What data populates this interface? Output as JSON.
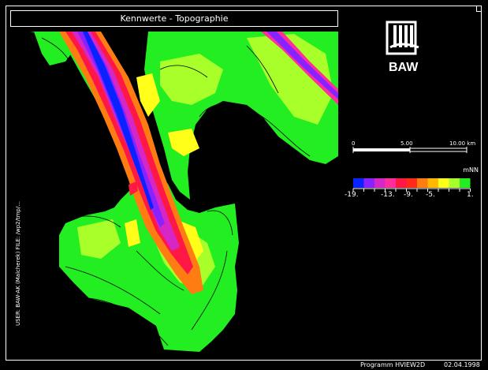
{
  "title": "Kennwerte - Topographie",
  "logo_text": "BAW",
  "scale": {
    "labels": [
      "0",
      "5.00",
      "10.00 km"
    ]
  },
  "legend": {
    "unit": "mNN",
    "colors": [
      "#0a22ff",
      "#8a22ff",
      "#d626c6",
      "#ff2e9a",
      "#ff1846",
      "#ff2a1a",
      "#ff7c12",
      "#ffb800",
      "#ffff1a",
      "#a8ff2a",
      "#22ee22"
    ],
    "tick_labels": [
      "-19.",
      "-13.",
      "-9.",
      "-5.",
      "1."
    ]
  },
  "side_text": "USER: BAW-AK (Malcherek)   FILE: /wp2/tmp/...",
  "footer": {
    "program": "Programm HVIEW2D",
    "date": "02.04.1998"
  },
  "colors": {
    "land_green": "#22ee22",
    "light_green": "#a8ff2a",
    "yellow": "#ffff1a",
    "orange": "#ff7c12",
    "red": "#ff1846",
    "magenta": "#d626c6",
    "purple": "#8a22ff",
    "blue": "#0a22ff",
    "background": "#000000"
  }
}
